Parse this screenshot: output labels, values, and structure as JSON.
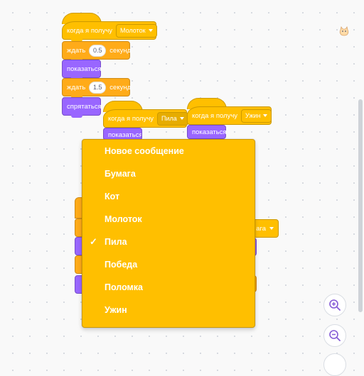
{
  "script_main": {
    "hat": {
      "label": "когда я получу",
      "message": "Молоток"
    },
    "wait1": {
      "prefix": "ждать",
      "value": "0.5",
      "suffix": "секунд"
    },
    "show": "показаться",
    "wait2": {
      "prefix": "ждать",
      "value": "1.5",
      "suffix": "секунд"
    },
    "hide": "спрятаться"
  },
  "script_pila": {
    "hat": {
      "label": "когда я получу",
      "message": "Пила"
    },
    "next_partial": "показаться"
  },
  "script_uzhin": {
    "hat": {
      "label": "когда я получу",
      "message": "Ужин"
    },
    "next": "показаться"
  },
  "hidden_block_partial": {
    "message_tail": "ага"
  },
  "dropdown_menu": {
    "items": [
      {
        "label": "Новое сообщение",
        "checked": false
      },
      {
        "label": "Бумага",
        "checked": false
      },
      {
        "label": "Кот",
        "checked": false
      },
      {
        "label": "Молоток",
        "checked": false
      },
      {
        "label": "Пила",
        "checked": true
      },
      {
        "label": "Победа",
        "checked": false
      },
      {
        "label": "Поломка",
        "checked": false
      },
      {
        "label": "Ужин",
        "checked": false
      }
    ],
    "checkmark": "✓"
  },
  "colors": {
    "events": "#ffbf00",
    "control": "#ffab19",
    "looks": "#9966ff"
  },
  "icons": {
    "zoom_in": "zoom-in-icon",
    "zoom_out": "zoom-out-icon",
    "sprite": "cat-sprite-icon"
  }
}
